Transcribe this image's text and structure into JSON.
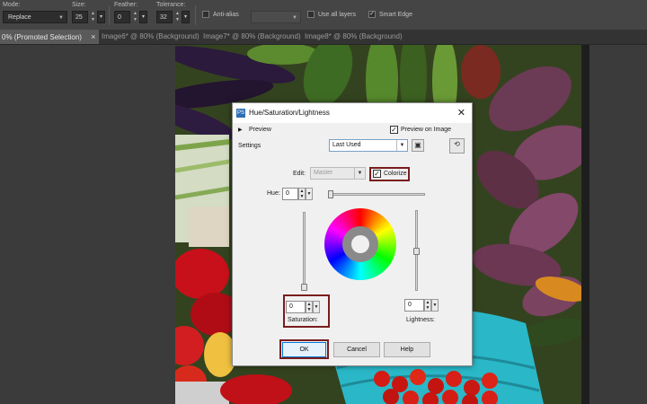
{
  "options_bar": {
    "mode_label": "Mode:",
    "mode_value": "Replace",
    "size_label": "Size:",
    "size_value": "25",
    "feather_label": "Feather:",
    "feather_value": "0",
    "tolerance_label": "Tolerance:",
    "tolerance_value": "32",
    "antialias_label": "Anti-alias",
    "use_all_layers_label": "Use all layers",
    "smart_edge_label": "Smart Edge",
    "smart_edge_checked": true
  },
  "tabs": [
    {
      "label": "0% (Promoted Selection)",
      "active": true
    },
    {
      "label": "Image6* @  80% (Background)",
      "active": false
    },
    {
      "label": "Image7* @  80% (Background)",
      "active": false
    },
    {
      "label": "Image8* @  80% (Background)",
      "active": false
    }
  ],
  "dialog": {
    "title": "Hue/Saturation/Lightness",
    "preview_label": "Preview",
    "preview_on_image_label": "Preview on Image",
    "preview_on_image_checked": true,
    "settings_label": "Settings",
    "settings_value": "Last Used",
    "edit_label": "Edit:",
    "edit_value": "Master",
    "colorize_label": "Colorize",
    "colorize_checked": true,
    "hue_label": "Hue:",
    "hue_value": "0",
    "saturation_label": "Saturation:",
    "saturation_value": "0",
    "lightness_label": "Lightness:",
    "lightness_value": "0",
    "ok_label": "OK",
    "cancel_label": "Cancel",
    "help_label": "Help"
  },
  "colors": {
    "highlight_red": "#7a1c1c",
    "ok_border": "#0078d7"
  }
}
